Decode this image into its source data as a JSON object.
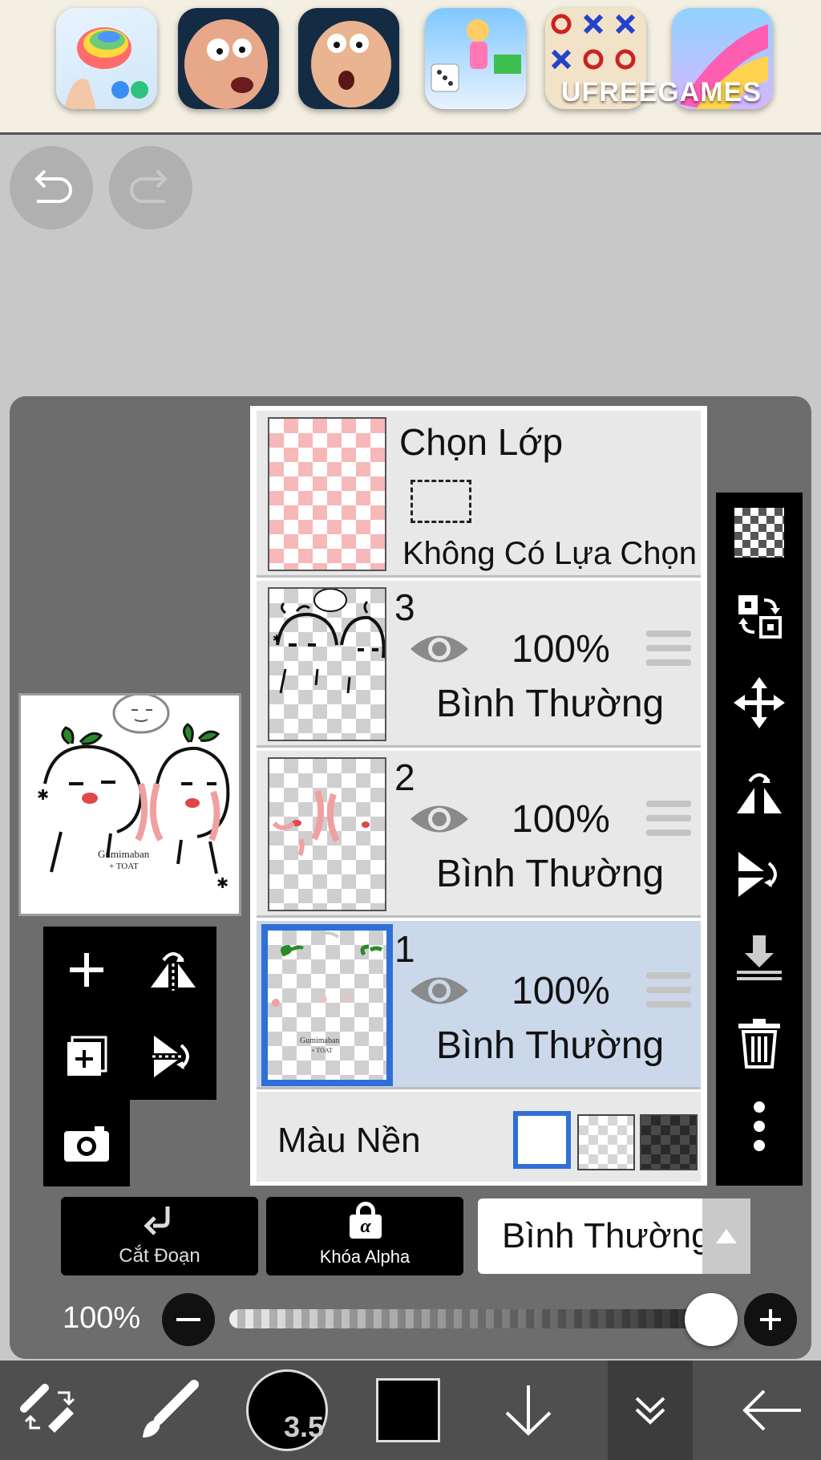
{
  "ad": {
    "brand": "UFREEGAMES",
    "games": [
      "pop-it-game-icon",
      "head-face-game-icon",
      "head-face-game-icon",
      "runner-dice-game-icon",
      "tic-tac-toe-game-icon",
      "slide-race-game-icon"
    ]
  },
  "layers_panel": {
    "selection": {
      "title": "Chọn Lớp",
      "subtitle": "Không Có Lựa Chọn"
    },
    "layers": [
      {
        "number": "3",
        "opacity": "100%",
        "blend": "Bình Thường",
        "selected": false
      },
      {
        "number": "2",
        "opacity": "100%",
        "blend": "Bình Thường",
        "selected": false
      },
      {
        "number": "1",
        "opacity": "100%",
        "blend": "Bình Thường",
        "selected": true
      }
    ],
    "background": {
      "label": "Màu Nền",
      "options": [
        "white",
        "transparent",
        "dark-checker"
      ],
      "selected": "white"
    }
  },
  "actions": {
    "clip_label": "Cắt Đoạn",
    "alpha_lock_label": "Khóa Alpha",
    "alpha_symbol": "α",
    "blend_mode": "Bình Thường"
  },
  "opacity": {
    "label": "100%",
    "value": 1.0
  },
  "bottom_nav": {
    "brush_size": "3.5",
    "color": "#000000"
  },
  "preview": {
    "caption_line1": "Gumimaban",
    "caption_line2": "+ TOAT"
  },
  "colors": {
    "selection_blue": "#2f6fd6",
    "selected_row": "#cbd8ea",
    "panel": "#6d6d6d"
  }
}
